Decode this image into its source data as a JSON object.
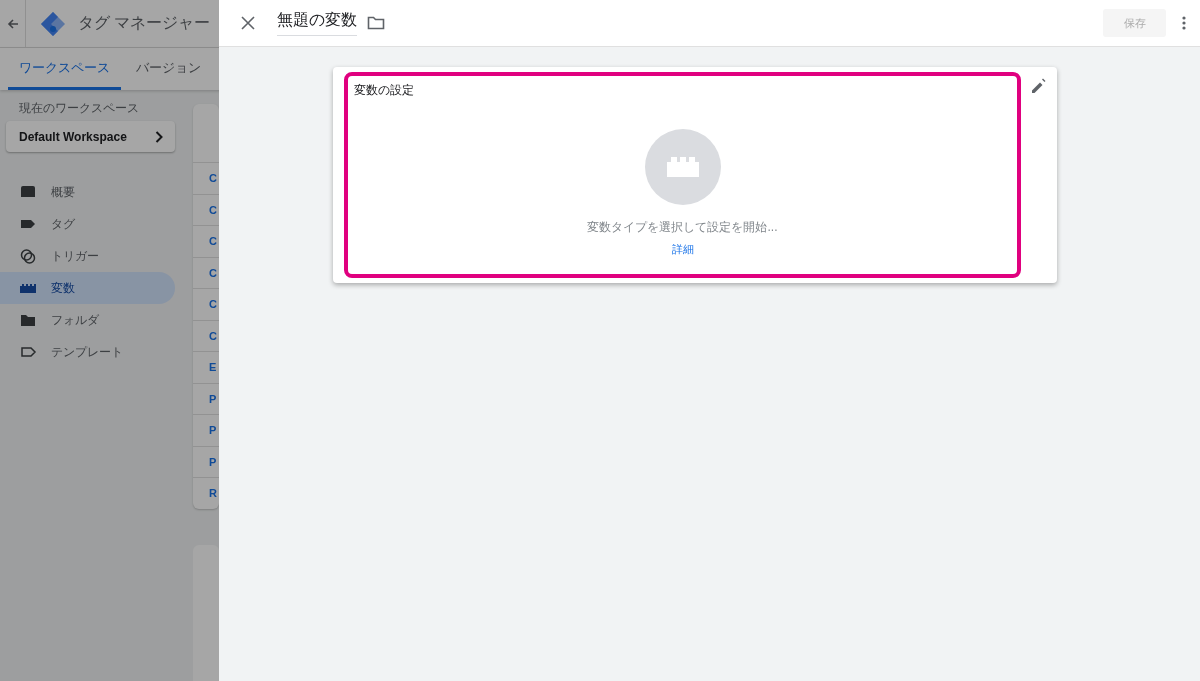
{
  "background": {
    "app_title": "タグ マネージャー",
    "tabs": [
      {
        "label": "ワークスペース",
        "selected": true
      },
      {
        "label": "バージョン",
        "selected": false
      }
    ],
    "workspace_label": "現在のワークスペース",
    "workspace": "Default Workspace",
    "nav": [
      {
        "label": "概要",
        "kind": "overview",
        "selected": false
      },
      {
        "label": "タグ",
        "kind": "tag",
        "selected": false
      },
      {
        "label": "トリガー",
        "kind": "trigger",
        "selected": false
      },
      {
        "label": "変数",
        "kind": "variable",
        "selected": true
      },
      {
        "label": "フォルダ",
        "kind": "folder",
        "selected": false
      },
      {
        "label": "テンプレート",
        "kind": "template",
        "selected": false
      }
    ],
    "list_rows": [
      "C",
      "C",
      "C",
      "C",
      "C",
      "C",
      "E",
      "P",
      "P",
      "P",
      "R"
    ]
  },
  "panel": {
    "title": "無題の変数",
    "save": "保存",
    "save_disabled": true,
    "card": {
      "title": "変数の設定",
      "hint": "変数タイプを選択して設定を開始...",
      "link": "詳細",
      "highlighted": true
    }
  }
}
